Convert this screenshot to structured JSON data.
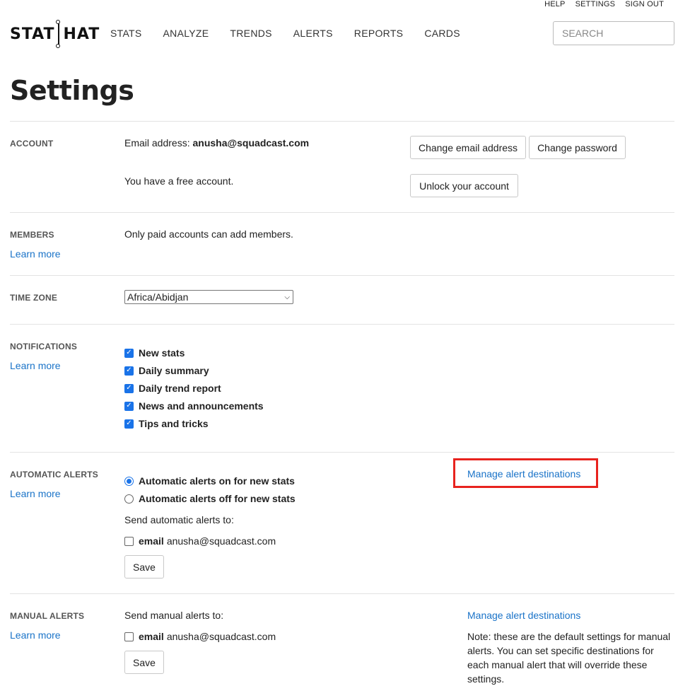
{
  "toplinks": {
    "help": "HELP",
    "settings": "SETTINGS",
    "signout": "SIGN OUT"
  },
  "logo": {
    "left": "STAT",
    "right": "HAT"
  },
  "nav": [
    "STATS",
    "ANALYZE",
    "TRENDS",
    "ALERTS",
    "REPORTS",
    "CARDS"
  ],
  "search": {
    "placeholder": "SEARCH"
  },
  "page_title": "Settings",
  "account": {
    "label": "ACCOUNT",
    "email_label": "Email address:",
    "email": "anusha@squadcast.com",
    "free_text": "You have a free account.",
    "change_email": "Change email address",
    "change_password": "Change password",
    "unlock": "Unlock your account"
  },
  "members": {
    "label": "MEMBERS",
    "learn": "Learn more",
    "text": "Only paid accounts can add members."
  },
  "timezone": {
    "label": "TIME ZONE",
    "value": "Africa/Abidjan"
  },
  "notifications": {
    "label": "NOTIFICATIONS",
    "learn": "Learn more",
    "items": [
      "New stats",
      "Daily summary",
      "Daily trend report",
      "News and announcements",
      "Tips and tricks"
    ]
  },
  "automatic_alerts": {
    "label": "AUTOMATIC ALERTS",
    "learn": "Learn more",
    "radio_on": "Automatic alerts on for new stats",
    "radio_off": "Automatic alerts off for new stats",
    "send_to": "Send automatic alerts to:",
    "email_label": "email",
    "email": "anusha@squadcast.com",
    "save": "Save",
    "manage": "Manage alert destinations"
  },
  "manual_alerts": {
    "label": "MANUAL ALERTS",
    "learn": "Learn more",
    "send_to": "Send manual alerts to:",
    "email_label": "email",
    "email": "anusha@squadcast.com",
    "save": "Save",
    "manage": "Manage alert destinations",
    "note": "Note: these are the default settings for manual alerts. You can set specific destinations for each manual alert that will override these settings."
  },
  "colors": {
    "link": "#1a73c8",
    "highlight": "#e8231e",
    "checkbox": "#1a73e8"
  }
}
